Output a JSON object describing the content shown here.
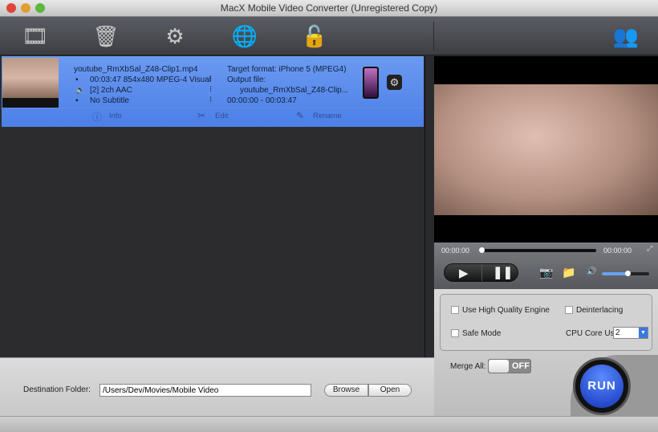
{
  "window": {
    "title": "MacX Mobile Video Converter (Unregistered Copy)"
  },
  "toolbar": {
    "icons": [
      "add-video-icon",
      "trash-icon",
      "settings-icon",
      "update-globe-icon",
      "unlock-icon",
      "users-icon"
    ]
  },
  "file": {
    "name": "youtube_RmXbSal_Z48-Clip1.mp4",
    "video": "00:03:47 854x480 MPEG-4 Visual",
    "audio": "[2] 2ch AAC",
    "subtitle": "No Subtitle",
    "target_format": "Target format: iPhone 5 (MPEG4)",
    "output_label": "Output file:",
    "output_name": "youtube_RmXbSal_Z48-Clip...",
    "range": "00:00:00 - 00:03:47",
    "actions": {
      "info": "Info",
      "edit": "Edit",
      "rename": "Rename"
    }
  },
  "destination": {
    "label": "Destination Folder:",
    "value": "/Users/Dev/Movies/Mobile Video",
    "browse": "Browse",
    "open": "Open"
  },
  "player": {
    "current": "00:00:00",
    "total": "00:00:00",
    "progress": 0,
    "volume": 0.55
  },
  "options": {
    "hq_engine": "Use High Quality Engine",
    "deinterlacing": "Deinterlacing",
    "safe_mode": "Safe Mode",
    "cpu_label": "CPU Core Use:",
    "cpu_value": "2",
    "merge_label": "Merge All:",
    "merge_state": "OFF",
    "run": "RUN"
  }
}
